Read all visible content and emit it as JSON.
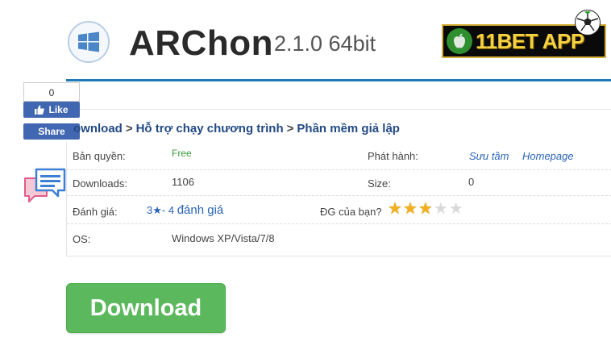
{
  "header": {
    "title": "ARChon",
    "version": "2.1.0 64bit",
    "ad_text": "11BET APP"
  },
  "social": {
    "like_count": "0",
    "like_label": "Like",
    "share_label": "Share"
  },
  "breadcrumb": {
    "items": [
      "ownload",
      "Hỗ trợ chạy chương trình",
      "Phần mềm giả lập"
    ],
    "separator": ">"
  },
  "info": {
    "license_label": "Bản quyền:",
    "license_value": "Free",
    "publisher_label": "Phát hành:",
    "publisher_link1": "Sưu tầm",
    "publisher_link2": "Homepage",
    "downloads_label": "Downloads:",
    "downloads_value": "1106",
    "size_label": "Size:",
    "size_value": "0",
    "rating_label": "Đánh giá:",
    "rating_value": "3★- 4",
    "rating_count_text": "đánh giá",
    "user_rating_label": "ĐG của bạn?",
    "user_rating_stars": 3,
    "user_rating_max": 5,
    "os_label": "OS:",
    "os_value": "Windows XP/Vista/7/8"
  },
  "download_button": {
    "label": "Download"
  },
  "colors": {
    "accent_blue": "#1f7ab8",
    "link_blue": "#234a84",
    "download_green": "#5cb85c",
    "star_gold": "#f2b01e",
    "facebook_blue": "#4267b2"
  },
  "icons": [
    "windows-logo-icon",
    "apple-icon",
    "soccer-ball-icon",
    "thumbs-up-icon",
    "comment-icon",
    "star-icon"
  ]
}
